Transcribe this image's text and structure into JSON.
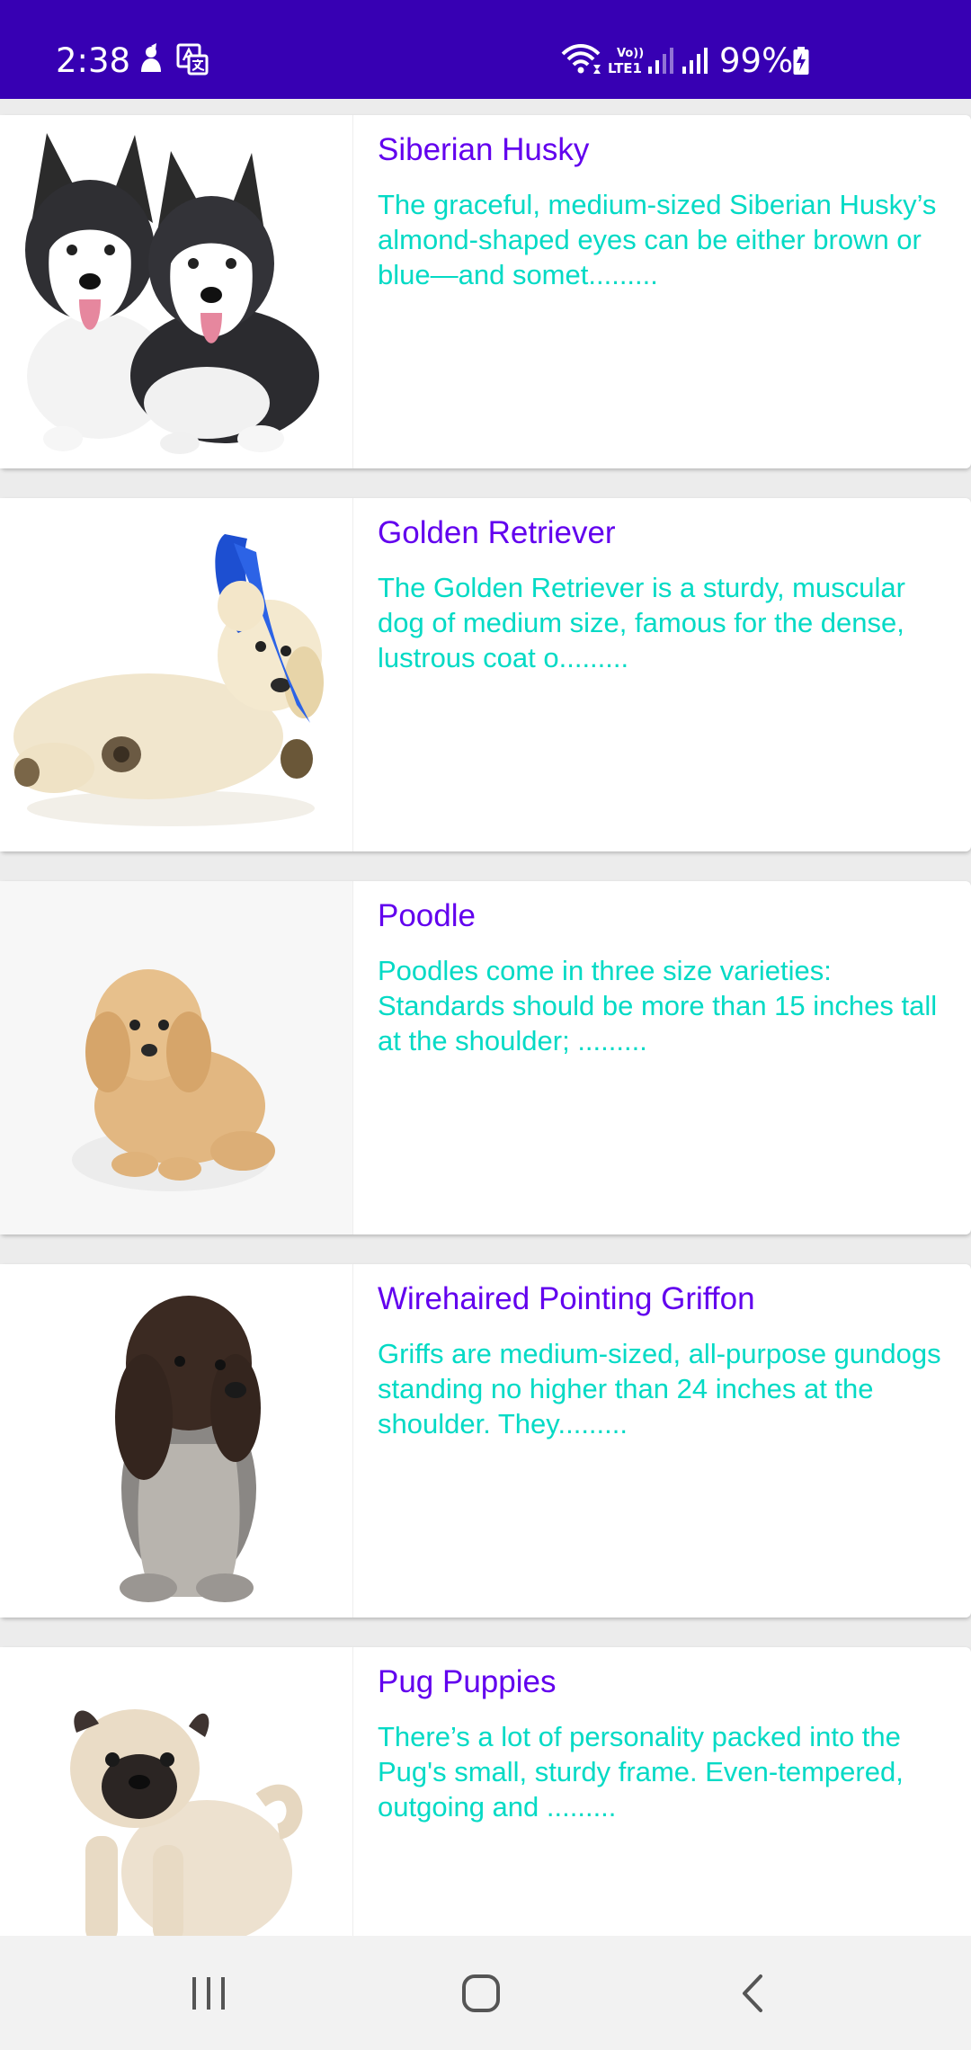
{
  "status_bar": {
    "time": "2:38",
    "battery_percent": "99%",
    "left_icons": [
      "notification-person-icon",
      "translate-icon"
    ],
    "right_icons": [
      "wifi-icon",
      "volte-lte1-icon",
      "signal-1-icon",
      "signal-2-icon",
      "battery-charging-icon"
    ],
    "volte_label_top": "Vo))",
    "volte_label_bottom": "LTE1",
    "background": "#3700b3"
  },
  "dogs": [
    {
      "title": "Siberian Husky",
      "description": "The graceful, medium-sized Siberian Husky’s almond-shaped eyes can be either brown or blue—and somet.........",
      "image": "siberian-husky-puppies"
    },
    {
      "title": "Golden Retriever",
      "description": "The Golden Retriever is a sturdy, muscular dog of medium size, famous for the dense, lustrous coat o.........",
      "image": "golden-retriever-puppy"
    },
    {
      "title": "Poodle",
      "description": "Poodles come in three size varieties: Standards should be more than 15 inches tall at the shoulder; .........",
      "image": "poodle-puppy"
    },
    {
      "title": "Wirehaired Pointing Griffon",
      "description": "Griffs are medium-sized, all-purpose gundogs standing no higher than 24 inches at the shoulder. They.........",
      "image": "griffon-puppy"
    },
    {
      "title": "Pug Puppies",
      "description": "There’s a lot of personality packed into the Pug's small, sturdy frame. Even-tempered, outgoing and .........",
      "image": "pug-puppy"
    }
  ],
  "colors": {
    "title": "#6200ee",
    "description": "#03dac5",
    "card_background": "#ffffff",
    "list_background": "#ececec"
  },
  "nav_bar": {
    "buttons": [
      "recents-icon",
      "home-icon",
      "back-icon"
    ]
  }
}
